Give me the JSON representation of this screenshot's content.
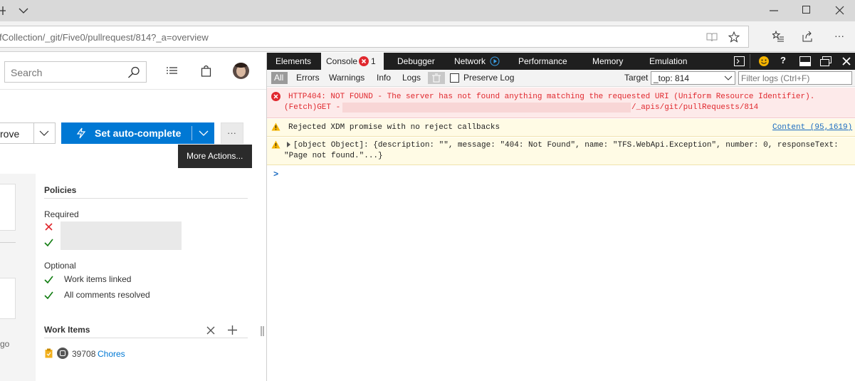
{
  "browser": {
    "url": "fCollection/_git/Five0/pullrequest/814?_a=overview"
  },
  "app": {
    "search": {
      "placeholder": "Search"
    },
    "actions": {
      "approve_label": "rove",
      "autocomplete_label": "Set auto-complete",
      "more_label": "···",
      "tooltip": "More Actions..."
    },
    "policies": {
      "title": "Policies",
      "required_label": "Required",
      "optional_label": "Optional",
      "optional_items": [
        "Work items linked",
        "All comments resolved"
      ]
    },
    "work_items": {
      "title": "Work Items",
      "item_id": "39708",
      "item_title": "Chores"
    },
    "left_fragment": "go"
  },
  "devtools": {
    "tabs": [
      "Elements",
      "Console",
      "Debugger",
      "Network",
      "Performance",
      "Memory",
      "Emulation"
    ],
    "console_error_count": "1",
    "filters": [
      "All",
      "Errors",
      "Warnings",
      "Info",
      "Logs"
    ],
    "preserve_log_label": "Preserve Log",
    "target_label": "Target",
    "target_value": "_top: 814",
    "filter_placeholder": "Filter logs (Ctrl+F)",
    "messages": [
      {
        "level": "error",
        "line1": "HTTP404: NOT FOUND - The server has not found anything matching the requested URI (Uniform Resource Identifier).",
        "line2_prefix": "(Fetch)GET - ",
        "line2_suffix": "/_apis/git/pullRequests/814"
      },
      {
        "level": "warning",
        "text": "Rejected XDM promise with no reject callbacks",
        "source": "Content (95,1619)"
      },
      {
        "level": "warning",
        "line1": "[object Object]: {description: \"\", message: \"404: Not Found\", name: \"TFS.WebApi.Exception\", number: 0, responseText:",
        "line2": "\"Page not found.\"...}"
      }
    ],
    "prompt": ">"
  },
  "colors": {
    "accent": "#0078d4",
    "error": "#e0282e",
    "warning": "#f5b400",
    "success": "#107c10"
  }
}
